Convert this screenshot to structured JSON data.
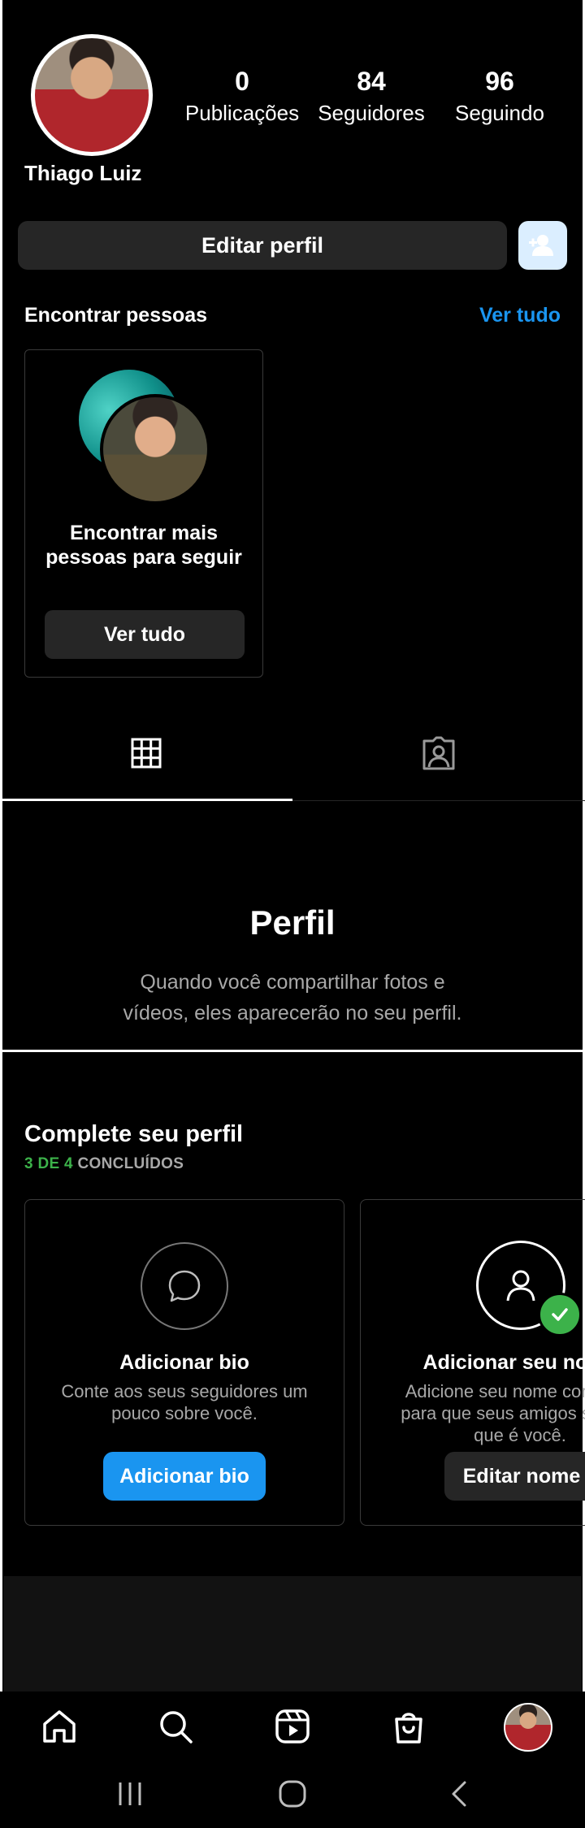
{
  "profile": {
    "username": "Thiago Luiz",
    "stats": [
      {
        "value": "0",
        "label": "Publicações"
      },
      {
        "value": "84",
        "label": "Seguidores"
      },
      {
        "value": "96",
        "label": "Seguindo"
      }
    ],
    "edit_label": "Editar perfil"
  },
  "discover": {
    "title": "Encontrar pessoas",
    "see_all": "Ver tudo",
    "card_text": "Encontrar mais pessoas para seguir",
    "card_button": "Ver tudo"
  },
  "tabs": [
    {
      "icon": "grid-icon",
      "active": true
    },
    {
      "icon": "tagged-icon",
      "active": false
    }
  ],
  "empty_state": {
    "title": "Perfil",
    "description": "Quando você compartilhar fotos e vídeos, eles aparecerão no seu perfil."
  },
  "complete": {
    "title": "Complete seu perfil",
    "progress_done": "3 DE 4",
    "progress_label": "CONCLUÍDOS",
    "cards": [
      {
        "icon": "speech-bubble-icon",
        "title": "Adicionar bio",
        "description": "Conte aos seus seguidores um pouco sobre você.",
        "button": "Adicionar bio"
      },
      {
        "icon": "person-icon",
        "title": "Adicionar seu nome",
        "description": "Adicione seu nome completo para que seus amigos saibam que é você.",
        "button": "Editar nome"
      }
    ]
  },
  "bottom_nav": [
    "home-icon",
    "search-icon",
    "reels-icon",
    "shop-icon",
    "profile-avatar"
  ],
  "colors": {
    "accent": "#1a95f0",
    "success": "#3cb24a",
    "button_bg": "#262626"
  }
}
